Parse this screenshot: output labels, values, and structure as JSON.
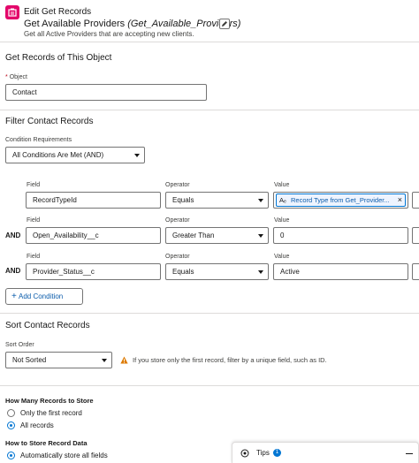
{
  "header": {
    "title": "Edit Get Records",
    "element_label": "Get Available Providers",
    "api_name": "(Get_Available_Providers)",
    "description": "Get all Active Providers that are accepting new clients."
  },
  "object_section": {
    "title": "Get Records of This Object",
    "required_mark": "*",
    "object_label": "Object",
    "object_value": "Contact"
  },
  "filter_section": {
    "title": "Filter Contact Records",
    "condition_label": "Condition Requirements",
    "condition_value": "All Conditions Are Met (AND)",
    "column_labels": {
      "field": "Field",
      "operator": "Operator",
      "value": "Value"
    },
    "rows": [
      {
        "connector": "",
        "field": "RecordTypeId",
        "operator": "Equals",
        "value": "Record Type from Get_Provider..."
      },
      {
        "connector": "AND",
        "field": "Open_Availability__c",
        "operator": "Greater Than",
        "value": "0"
      },
      {
        "connector": "AND",
        "field": "Provider_Status__c",
        "operator": "Equals",
        "value": "Active"
      }
    ],
    "add_condition_label": "Add Condition"
  },
  "sort_section": {
    "title": "Sort Contact Records",
    "sort_label": "Sort Order",
    "sort_value": "Not Sorted",
    "warning": "If you store only the first record, filter by a unique field, such as ID."
  },
  "store_section": {
    "how_many_label": "How Many Records to Store",
    "options": [
      {
        "label": "Only the first record",
        "selected": false
      },
      {
        "label": "All records",
        "selected": true
      }
    ],
    "how_to_label": "How to Store Record Data",
    "store_option": "Automatically store all fields"
  },
  "tips": {
    "label": "Tips",
    "count": "1"
  },
  "colors": {
    "accent": "#0176d3",
    "icon_bg": "#e3066a"
  }
}
